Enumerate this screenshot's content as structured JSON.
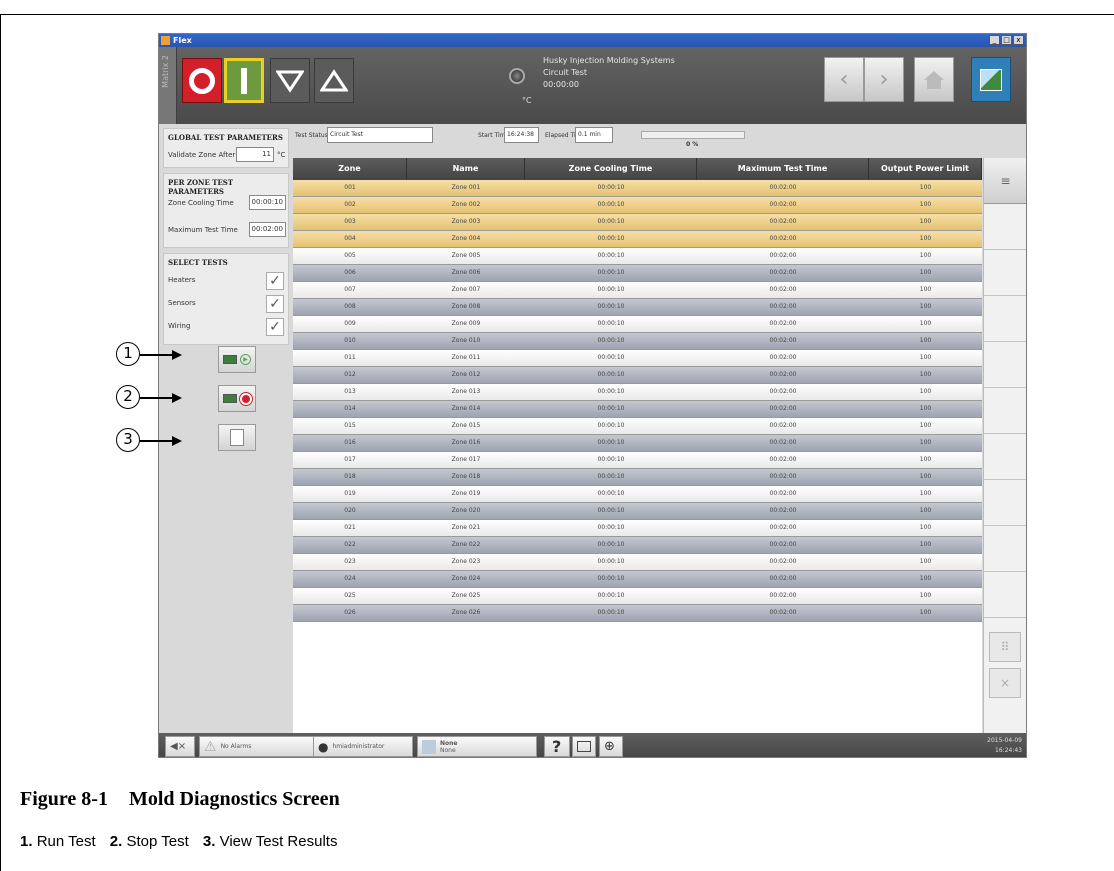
{
  "window": {
    "title": "Flex",
    "controls": [
      "_",
      "□",
      "x"
    ]
  },
  "topbar": {
    "mold_tab": "Matrix 2",
    "system_name": "Husky Injection Molding Systems",
    "screen_name": "Circuit Test",
    "timer": "00:00:00",
    "temp_unit": "°C"
  },
  "global_params": {
    "heading": "GLOBAL TEST PARAMETERS",
    "validate_label": "Validate Zone After",
    "validate_value": "11",
    "validate_unit": "°C"
  },
  "per_zone_params": {
    "heading": "PER ZONE TEST PARAMETERS",
    "cooling_label": "Zone Cooling Time",
    "cooling_value": "00:00:10",
    "max_label": "Maximum Test Time",
    "max_value": "00:02:00"
  },
  "select_tests": {
    "heading": "SELECT TESTS",
    "items": [
      {
        "label": "Heaters",
        "checked": true
      },
      {
        "label": "Sensors",
        "checked": true
      },
      {
        "label": "Wiring",
        "checked": true
      }
    ]
  },
  "status": {
    "test_status_label": "Test Status",
    "test_status_value": "Circuit Test",
    "start_time_label": "Start Time",
    "start_time_value": "16:24:38",
    "elapsed_label": "Elapsed Time",
    "elapsed_value": "0.1 min",
    "progress_percent": 0,
    "progress_text": "0 %"
  },
  "table": {
    "columns": [
      "Zone",
      "Name",
      "Zone Cooling Time",
      "Maximum Test Time",
      "Output Power Limit"
    ],
    "rows": [
      [
        "001",
        "Zone 001",
        "00:00:10",
        "00:02:00",
        "100"
      ],
      [
        "002",
        "Zone 002",
        "00:00:10",
        "00:02:00",
        "100"
      ],
      [
        "003",
        "Zone 003",
        "00:00:10",
        "00:02:00",
        "100"
      ],
      [
        "004",
        "Zone 004",
        "00:00:10",
        "00:02:00",
        "100"
      ],
      [
        "005",
        "Zone 005",
        "00:00:10",
        "00:02:00",
        "100"
      ],
      [
        "006",
        "Zone 006",
        "00:00:10",
        "00:02:00",
        "100"
      ],
      [
        "007",
        "Zone 007",
        "00:00:10",
        "00:02:00",
        "100"
      ],
      [
        "008",
        "Zone 008",
        "00:00:10",
        "00:02:00",
        "100"
      ],
      [
        "009",
        "Zone 009",
        "00:00:10",
        "00:02:00",
        "100"
      ],
      [
        "010",
        "Zone 010",
        "00:00:10",
        "00:02:00",
        "100"
      ],
      [
        "011",
        "Zone 011",
        "00:00:10",
        "00:02:00",
        "100"
      ],
      [
        "012",
        "Zone 012",
        "00:00:10",
        "00:02:00",
        "100"
      ],
      [
        "013",
        "Zone 013",
        "00:00:10",
        "00:02:00",
        "100"
      ],
      [
        "014",
        "Zone 014",
        "00:00:10",
        "00:02:00",
        "100"
      ],
      [
        "015",
        "Zone 015",
        "00:00:10",
        "00:02:00",
        "100"
      ],
      [
        "016",
        "Zone 016",
        "00:00:10",
        "00:02:00",
        "100"
      ],
      [
        "017",
        "Zone 017",
        "00:00:10",
        "00:02:00",
        "100"
      ],
      [
        "018",
        "Zone 018",
        "00:00:10",
        "00:02:00",
        "100"
      ],
      [
        "019",
        "Zone 019",
        "00:00:10",
        "00:02:00",
        "100"
      ],
      [
        "020",
        "Zone 020",
        "00:00:10",
        "00:02:00",
        "100"
      ],
      [
        "021",
        "Zone 021",
        "00:00:10",
        "00:02:00",
        "100"
      ],
      [
        "022",
        "Zone 022",
        "00:00:10",
        "00:02:00",
        "100"
      ],
      [
        "023",
        "Zone 023",
        "00:00:10",
        "00:02:00",
        "100"
      ],
      [
        "024",
        "Zone 024",
        "00:00:10",
        "00:02:00",
        "100"
      ],
      [
        "025",
        "Zone 025",
        "00:00:10",
        "00:02:00",
        "100"
      ],
      [
        "026",
        "Zone 026",
        "00:00:10",
        "00:02:00",
        "100"
      ]
    ],
    "selected_rows": 4
  },
  "footer": {
    "alarms": "No Alarms",
    "user": "hmiadministrator",
    "mold_line1": "None",
    "mold_line2": "None",
    "help": "?",
    "date": "2015-04-09",
    "time": "16:24:43"
  },
  "callouts": [
    "1",
    "2",
    "3"
  ],
  "caption": {
    "number": "Figure 8-1",
    "title": "Mold Diagnostics Screen"
  },
  "legend": [
    {
      "num": "1.",
      "text": "Run Test"
    },
    {
      "num": "2.",
      "text": "Stop Test"
    },
    {
      "num": "3.",
      "text": "View Test Results"
    }
  ],
  "icons": {
    "stop": "stop-icon",
    "start": "start-icon",
    "jog_down": "down-triangle-icon",
    "jog_up": "up-triangle-icon",
    "back": "chevron-left-icon",
    "forward": "chevron-right-icon",
    "home": "home-icon",
    "screens": "screens-icon",
    "mute": "speaker-mute-icon",
    "alarm": "warning-icon",
    "user": "user-icon",
    "globe": "globe-icon"
  },
  "colors": {
    "stop_red": "#d21f2a",
    "start_green": "#6d9a3c",
    "selected_row": "#f0d48f",
    "header_dark": "#4a4a4a"
  }
}
